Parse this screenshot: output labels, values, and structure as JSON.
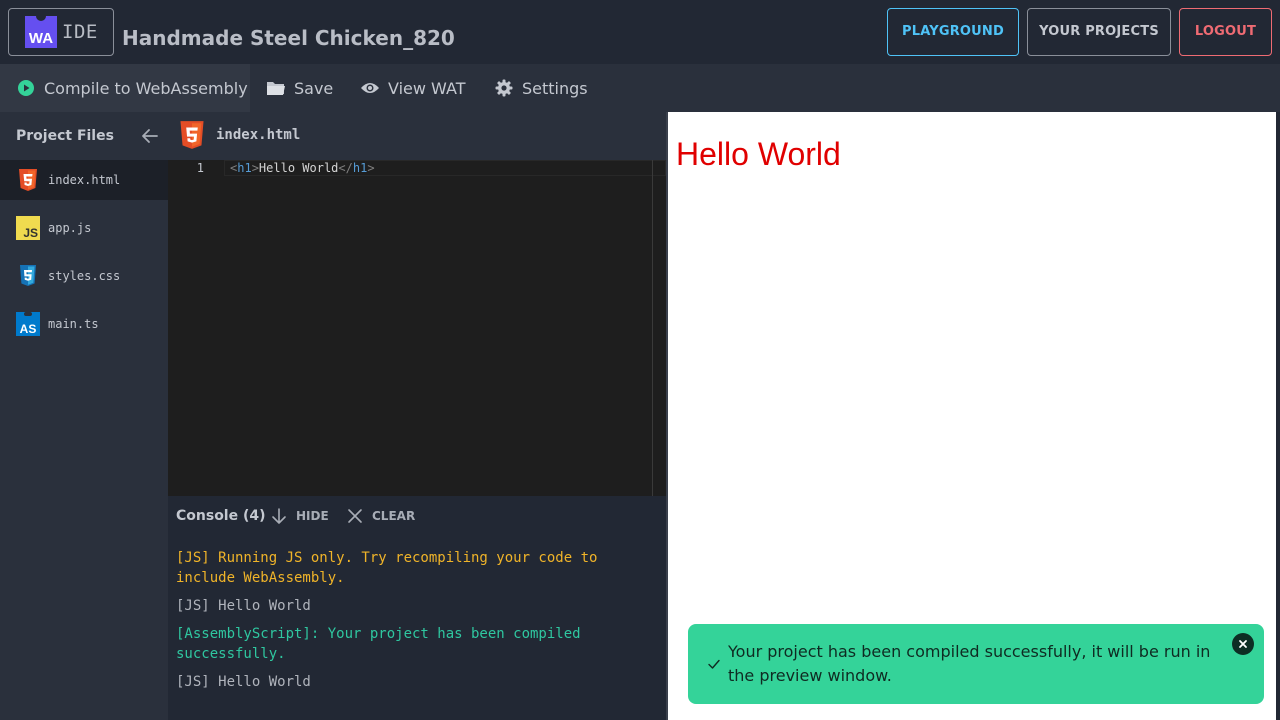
{
  "header": {
    "logo_badge": "WA",
    "logo_text": "IDE",
    "project_title": "Handmade Steel Chicken_820",
    "buttons": {
      "playground": "PLAYGROUND",
      "projects": "YOUR PROJECTS",
      "logout": "LOGOUT"
    }
  },
  "toolbar": {
    "compile": "Compile to WebAssembly",
    "save": "Save",
    "view_wat": "View WAT",
    "settings": "Settings"
  },
  "sidebar": {
    "title": "Project Files",
    "files": [
      {
        "name": "index.html",
        "icon": "html5-icon",
        "active": true
      },
      {
        "name": "app.js",
        "icon": "javascript-icon"
      },
      {
        "name": "styles.css",
        "icon": "css3-icon"
      },
      {
        "name": "main.ts",
        "icon": "assemblyscript-icon"
      }
    ]
  },
  "editor": {
    "tab_name": "index.html",
    "line_number": "1",
    "code": {
      "open_tag": "h1",
      "content": "Hello World",
      "close_tag": "h1"
    }
  },
  "console": {
    "title": "Console (4)",
    "hide": "HIDE",
    "clear": "CLEAR",
    "logs": [
      {
        "text": "[JS] Running JS only. Try recompiling your code to include WebAssembly.",
        "level": "warning",
        "color": "#f0b429"
      },
      {
        "text": "[JS] Hello World",
        "level": "info",
        "color": "#b0b4bc"
      },
      {
        "text": "[AssemblyScript]: Your project has been compiled successfully.",
        "level": "success",
        "color": "#2fc7a0"
      },
      {
        "text": "[JS] Hello World",
        "level": "info",
        "color": "#b0b4bc"
      }
    ]
  },
  "preview": {
    "heading": "Hello World"
  },
  "toast": {
    "message": "Your project has been compiled successfully, it will be run in the preview window.",
    "color": "#34d399"
  },
  "colors": {
    "accent_blue": "#4fc3f7",
    "logout_red": "#ef6b73",
    "wa_purple": "#654ff0",
    "success_green": "#34d399"
  }
}
